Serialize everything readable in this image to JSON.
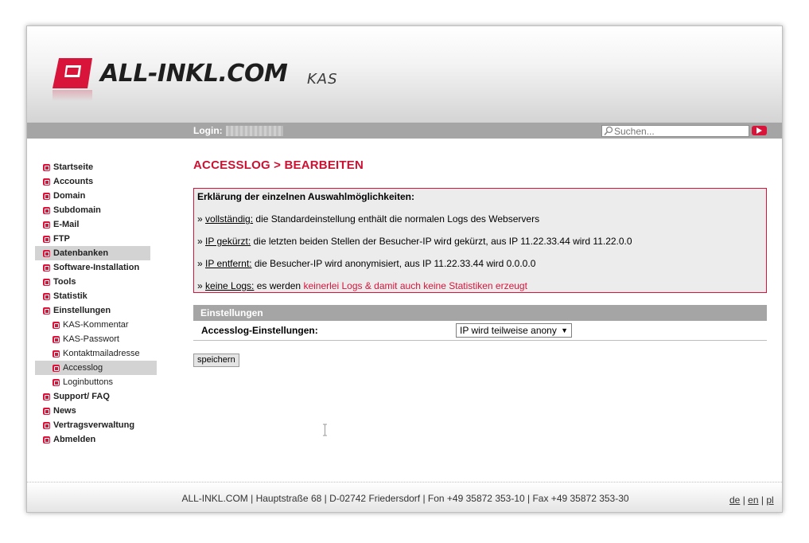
{
  "header": {
    "logo_text": "ALL-INKL.COM",
    "logo_suffix": "KAS"
  },
  "topbar": {
    "login_label": "Login:",
    "search_placeholder": "Suchen..."
  },
  "sidebar": {
    "items": [
      {
        "label": "Startseite",
        "sub": false,
        "active": false
      },
      {
        "label": "Accounts",
        "sub": false,
        "active": false
      },
      {
        "label": "Domain",
        "sub": false,
        "active": false
      },
      {
        "label": "Subdomain",
        "sub": false,
        "active": false
      },
      {
        "label": "E-Mail",
        "sub": false,
        "active": false
      },
      {
        "label": "FTP",
        "sub": false,
        "active": false
      },
      {
        "label": "Datenbanken",
        "sub": false,
        "active": true
      },
      {
        "label": "Software-Installation",
        "sub": false,
        "active": false
      },
      {
        "label": "Tools",
        "sub": false,
        "active": false
      },
      {
        "label": "Statistik",
        "sub": false,
        "active": false
      },
      {
        "label": "Einstellungen",
        "sub": false,
        "active": false
      },
      {
        "label": "KAS-Kommentar",
        "sub": true,
        "active": false
      },
      {
        "label": "KAS-Passwort",
        "sub": true,
        "active": false
      },
      {
        "label": "Kontaktmailadresse",
        "sub": true,
        "active": false
      },
      {
        "label": "Accesslog",
        "sub": true,
        "active": true
      },
      {
        "label": "Loginbuttons",
        "sub": true,
        "active": false
      },
      {
        "label": "Support/ FAQ",
        "sub": false,
        "active": false
      },
      {
        "label": "News",
        "sub": false,
        "active": false
      },
      {
        "label": "Vertragsverwaltung",
        "sub": false,
        "active": false
      },
      {
        "label": "Abmelden",
        "sub": false,
        "active": false
      }
    ]
  },
  "main": {
    "title": "ACCESSLOG > BEARBEITEN",
    "info": {
      "heading": "Erklärung der einzelnen Auswahlmöglichkeiten:",
      "lines": [
        {
          "prefix": "» ",
          "term": "vollständig:",
          "text": " die Standardeinstellung enthält die normalen Logs des Webservers",
          "warn": ""
        },
        {
          "prefix": "» ",
          "term": "IP gekürzt:",
          "text": " die letzten beiden Stellen der Besucher-IP wird gekürzt, aus IP 11.22.33.44 wird 11.22.0.0",
          "warn": ""
        },
        {
          "prefix": "» ",
          "term": "IP entfernt:",
          "text": " die Besucher-IP wird anonymisiert, aus IP 11.22.33.44 wird 0.0.0.0",
          "warn": ""
        },
        {
          "prefix": "» ",
          "term": "keine Logs:",
          "text": " es werden ",
          "warn": "keinerlei Logs & damit auch keine Statistiken erzeugt"
        }
      ]
    },
    "settings": {
      "header": "Einstellungen",
      "label": "Accesslog-Einstellungen:",
      "selected_option": "IP wird teilweise anony",
      "dropdown_arrow": "▼"
    },
    "save_label": "speichern"
  },
  "footer": {
    "address": "ALL-INKL.COM | Hauptstraße 68 | D-02742 Friedersdorf | Fon +49 35872 353-10 | Fax +49 35872 353-30",
    "languages": [
      "de",
      "en",
      "pl"
    ],
    "separator": " | "
  },
  "colors": {
    "accent": "#cc1133",
    "bar_gray": "#a5a5a5",
    "info_bg": "#ececec"
  }
}
